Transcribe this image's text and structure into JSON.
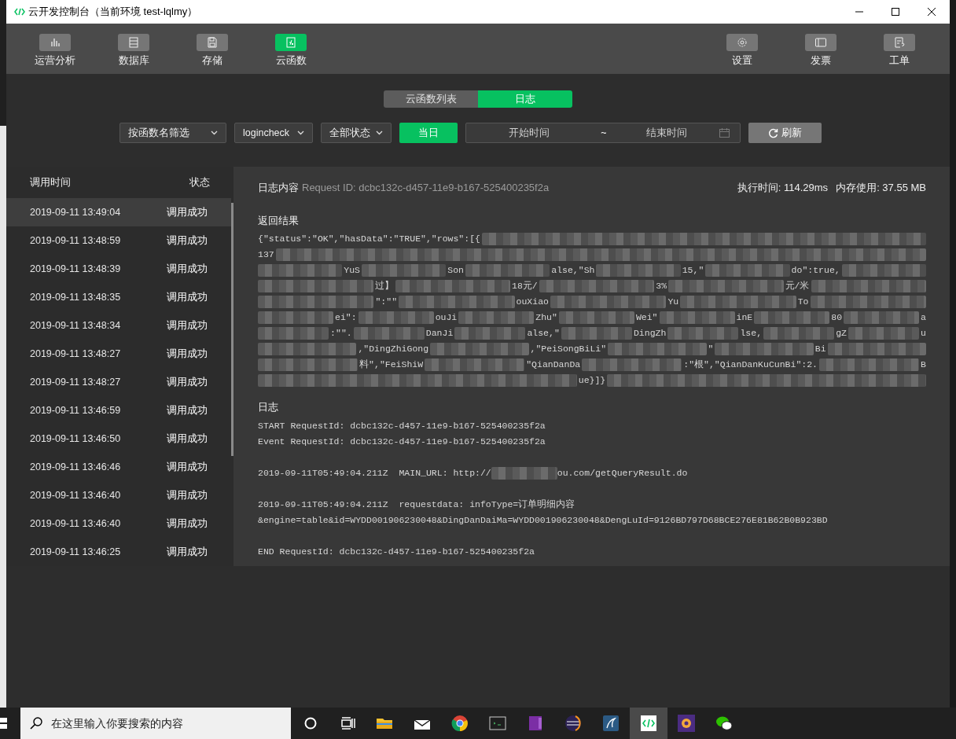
{
  "window": {
    "title": "云开发控制台（当前环境 test-lqlmy）"
  },
  "toolbar": {
    "left": [
      {
        "label": "运营分析",
        "kind": "chart",
        "selected": false
      },
      {
        "label": "数据库",
        "kind": "database",
        "selected": false
      },
      {
        "label": "存储",
        "kind": "storage",
        "selected": false
      },
      {
        "label": "云函数",
        "kind": "function",
        "selected": true
      }
    ],
    "right": [
      {
        "label": "设置",
        "kind": "gear"
      },
      {
        "label": "发票",
        "kind": "ticket"
      },
      {
        "label": "工单",
        "kind": "form"
      }
    ]
  },
  "tabs": [
    {
      "label": "云函数列表",
      "selected": false
    },
    {
      "label": "日志",
      "selected": true
    }
  ],
  "filters": {
    "function_filter": "按函数名筛选",
    "function_name": "logincheck",
    "status_filter": "全部状态",
    "today_button": "当日",
    "start_placeholder": "开始时间",
    "separator": "~",
    "end_placeholder": "结束时间",
    "refresh_button": "刷新"
  },
  "log_list": {
    "columns": [
      "调用时间",
      "状态"
    ],
    "rows": [
      {
        "time": "2019-09-11 13:49:04",
        "status": "调用成功",
        "selected": true
      },
      {
        "time": "2019-09-11 13:48:59",
        "status": "调用成功",
        "selected": false
      },
      {
        "time": "2019-09-11 13:48:39",
        "status": "调用成功",
        "selected": false
      },
      {
        "time": "2019-09-11 13:48:35",
        "status": "调用成功",
        "selected": false
      },
      {
        "time": "2019-09-11 13:48:34",
        "status": "调用成功",
        "selected": false
      },
      {
        "time": "2019-09-11 13:48:27",
        "status": "调用成功",
        "selected": false
      },
      {
        "time": "2019-09-11 13:48:27",
        "status": "调用成功",
        "selected": false
      },
      {
        "time": "2019-09-11 13:46:59",
        "status": "调用成功",
        "selected": false
      },
      {
        "time": "2019-09-11 13:46:50",
        "status": "调用成功",
        "selected": false
      },
      {
        "time": "2019-09-11 13:46:46",
        "status": "调用成功",
        "selected": false
      },
      {
        "time": "2019-09-11 13:46:40",
        "status": "调用成功",
        "selected": false
      },
      {
        "time": "2019-09-11 13:46:40",
        "status": "调用成功",
        "selected": false
      },
      {
        "time": "2019-09-11 13:46:25",
        "status": "调用成功",
        "selected": false
      }
    ]
  },
  "detail": {
    "title": "日志内容",
    "request_id": "Request ID: dcbc132c-d457-11e9-b167-525400235f2a",
    "exec_time": "执行时间: 114.29ms",
    "memory": "内存使用: 37.55 MB",
    "result_heading": "返回结果",
    "result_lines": [
      {
        "parts": [
          "{\"status\":\"OK\",\"hasData\":\"TRUE\",\"rows\":[{"
        ],
        "mask_before": false,
        "mask_after": true
      },
      {
        "parts": [
          "137"
        ],
        "mask_before": false,
        "mask_after": true
      },
      {
        "parts": [
          "YuS",
          "Son",
          "alse,\"Sh",
          "15,\"",
          "do\":true,"
        ],
        "mask_before": true,
        "mask_after": true
      },
      {
        "parts": [
          "过】",
          "18元/",
          "3%",
          "元/米"
        ],
        "mask_before": true,
        "mask_after": true
      },
      {
        "parts": [
          "\":\"\"",
          "ouXiao",
          "Yu",
          "To"
        ],
        "mask_before": true,
        "mask_after": true
      },
      {
        "parts": [
          "ei\":",
          "ouJi",
          "Zhu\"",
          "Wei\"",
          "inE",
          "80",
          "a"
        ],
        "mask_before": true,
        "mask_after": false
      },
      {
        "parts": [
          ":\"\".",
          "DanJi",
          "alse,\"",
          "DingZh",
          "lse,",
          "gZ",
          "u"
        ],
        "mask_before": true,
        "mask_after": false
      },
      {
        "parts": [
          ",\"DingZhiGong",
          ",\"PeiSongBiLi\"",
          "\"",
          "Bi"
        ],
        "mask_before": true,
        "mask_after": true
      },
      {
        "parts": [
          "料\",\"FeiShiW",
          "\"QianDanDa",
          ":\"根\",\"QianDanKuCunBi\":2.",
          "B"
        ],
        "mask_before": true,
        "mask_after": false
      },
      {
        "parts": [
          "ue}]}"
        ],
        "mask_before": true,
        "mask_after": true
      }
    ],
    "log_heading": "日志",
    "log_blocks": [
      [
        {
          "parts": [
            "START RequestId: dcbc132c-d457-11e9-b167-525400235f2a"
          ]
        },
        {
          "parts": [
            "Event RequestId: dcbc132c-d457-11e9-b167-525400235f2a"
          ]
        }
      ],
      [
        {
          "parts": [
            "2019-09-11T05:49:04.211Z  MAIN_URL: http://",
            "ou.com/getQueryResult.do"
          ]
        }
      ],
      [
        {
          "parts": [
            "2019-09-11T05:49:04.211Z  requestdata: infoType=订单明细内容"
          ]
        },
        {
          "parts": [
            "&engine=table&id=WYDD001906230048&DingDanDaiMa=WYDD001906230048&DengLuId=9126BD797D68BCE276E81B62B0B923BD"
          ]
        }
      ],
      [
        {
          "parts": [
            "END RequestId: dcbc132c-d457-11e9-b167-525400235f2a"
          ]
        }
      ]
    ]
  },
  "taskbar": {
    "search_placeholder": "在这里输入你要搜索的内容",
    "apps": [
      {
        "kind": "folder",
        "active": false
      },
      {
        "kind": "mail",
        "active": false
      },
      {
        "kind": "browser",
        "active": false
      },
      {
        "kind": "terminal",
        "active": false
      },
      {
        "kind": "notebook",
        "active": false
      },
      {
        "kind": "eclipse",
        "active": false
      },
      {
        "kind": "dolphin",
        "active": false
      },
      {
        "kind": "devtools",
        "active": true
      },
      {
        "kind": "ide",
        "active": false
      },
      {
        "kind": "chat",
        "active": false
      }
    ]
  }
}
